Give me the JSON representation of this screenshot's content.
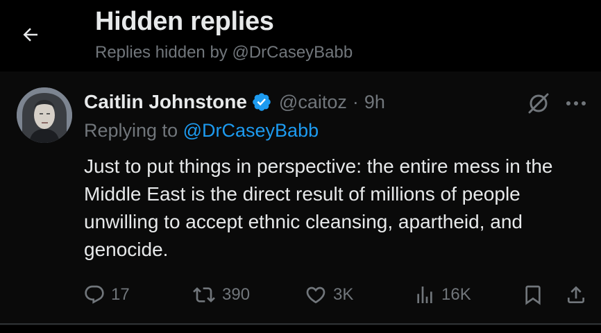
{
  "header": {
    "title": "Hidden replies",
    "subtitle": "Replies hidden by @DrCaseyBabb"
  },
  "tweet": {
    "author_name": "Caitlin Johnstone",
    "handle": "@caitoz",
    "separator": "·",
    "time": "9h",
    "replying_prefix": "Replying to",
    "replying_to": "@DrCaseyBabb",
    "text": "Just to put things in perspective: the entire mess in the Middle East is the direct result of millions of people unwilling to accept ethnic cleansing, apartheid, and genocide."
  },
  "actions": {
    "replies": "17",
    "reposts": "390",
    "likes": "3K",
    "views": "16K"
  },
  "icons": {
    "back": "arrow-left-icon",
    "verified": "verified-badge-icon",
    "hide": "hide-reply-icon",
    "more": "more-icon",
    "reply": "reply-icon",
    "repost": "repost-icon",
    "like": "heart-icon",
    "views": "views-icon",
    "bookmark": "bookmark-icon",
    "share": "share-icon"
  },
  "colors": {
    "background": "#000000",
    "text": "#e7e9ea",
    "muted": "#71767b",
    "accent": "#1d9bf0"
  }
}
